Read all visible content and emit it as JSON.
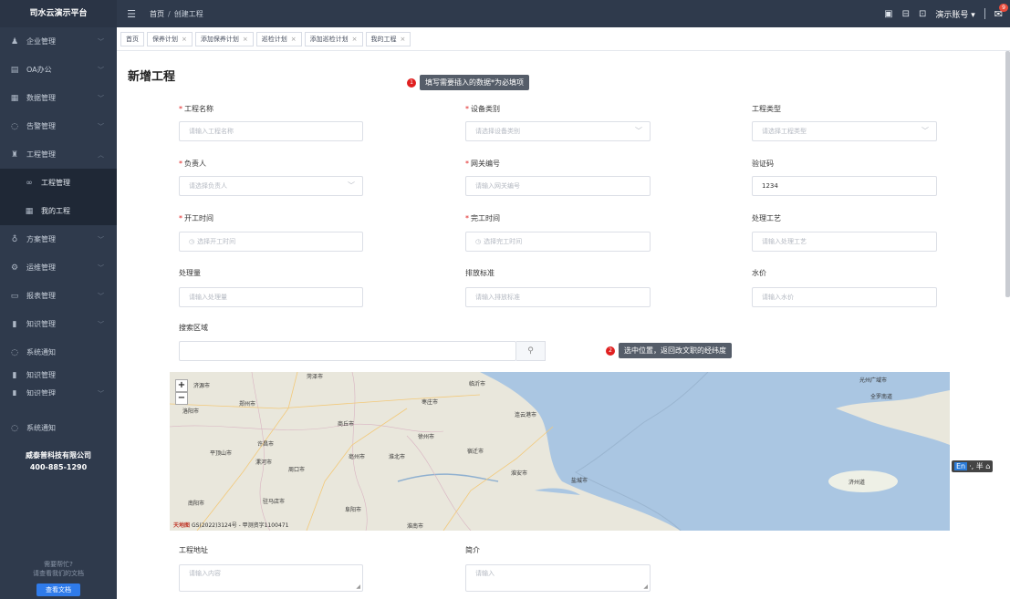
{
  "sidebar": {
    "brand": "司水云演示平台",
    "items": [
      {
        "icon": "user-icon",
        "label": "企业管理",
        "chev": "﹀"
      },
      {
        "icon": "document-icon",
        "label": "OA办公",
        "chev": "﹀"
      },
      {
        "icon": "database-icon",
        "label": "数据管理",
        "chev": "﹀"
      },
      {
        "icon": "alarm-icon",
        "label": "告警管理",
        "chev": "﹀"
      },
      {
        "icon": "project-icon",
        "label": "工程管理",
        "chev": "︿"
      }
    ],
    "sub_items": [
      {
        "icon": "link-icon",
        "label": "工程管理"
      },
      {
        "icon": "grid-icon",
        "label": "我的工程"
      }
    ],
    "items2": [
      {
        "icon": "scheme-icon",
        "label": "方案管理",
        "chev": "﹀"
      },
      {
        "icon": "ops-icon",
        "label": "运维管理",
        "chev": "﹀"
      },
      {
        "icon": "report-icon",
        "label": "报表管理",
        "chev": "﹀"
      },
      {
        "icon": "knowledge-icon",
        "label": "知识管理",
        "chev": "﹀"
      },
      {
        "icon": "notify-icon",
        "label": "系统通知",
        "chev": ""
      }
    ],
    "overlap_top": "知识管理",
    "overlap_bottom": "知识管理",
    "system_notice2": "系统通知",
    "company_name": "威泰普科技有限公司",
    "company_phone": "400-885-1290",
    "help_line1": "需要帮忙?",
    "help_line2": "请查看我们的文档",
    "doc_button": "查看文档"
  },
  "topbar": {
    "menu_toggle": "☰",
    "crumb_home": "首页",
    "crumb_sep": "/",
    "crumb_current": "创建工程",
    "user": "演示账号 ▾",
    "notify_badge": "9"
  },
  "tabs": [
    {
      "label": "首页",
      "closable": false
    },
    {
      "label": "保养计划",
      "closable": true
    },
    {
      "label": "添加保养计划",
      "closable": true
    },
    {
      "label": "巡检计划",
      "closable": true
    },
    {
      "label": "添加巡检计划",
      "closable": true
    },
    {
      "label": "我的工程",
      "closable": true
    }
  ],
  "form": {
    "title": "新增工程",
    "hint1_num": "1",
    "hint1": "填写需要插入的数据*为必填项",
    "hint2_num": "2",
    "hint2": "选中位置，返回改文职的经纬度",
    "project_name_label": "工程名称",
    "project_name_placeholder": "请输入工程名称",
    "device_type_label": "设备类别",
    "device_type_placeholder": "请选择设备类别",
    "project_type_label": "工程类型",
    "project_type_placeholder": "请选择工程类型",
    "owner_label": "负责人",
    "owner_placeholder": "请选择负责人",
    "gateway_label": "网关编号",
    "gateway_placeholder": "请输入网关编号",
    "code_label": "验证码",
    "code_value": "1234",
    "start_label": "开工时间",
    "start_placeholder": "选择开工时间",
    "end_label": "完工时间",
    "end_placeholder": "选择完工时间",
    "process_label": "处理工艺",
    "process_placeholder": "请输入处理工艺",
    "volume_label": "处理量",
    "volume_placeholder": "请输入处理量",
    "standard_label": "排放标准",
    "standard_placeholder": "请输入排放标准",
    "price_label": "水价",
    "price_placeholder": "请输入水价",
    "area_label": "搜索区域",
    "address_label": "工程地址",
    "address_placeholder": "请输入内容",
    "intro_label": "简介",
    "intro_placeholder": "请输入"
  },
  "map": {
    "zoom_in": "+",
    "zoom_out": "−",
    "copyright": "GS(2022)3124号 - 甲测资字1100471",
    "logo": "天地图",
    "cities": [
      "济源市",
      "郑州市",
      "洛阳市",
      "许昌市",
      "平顶山市",
      "漯河市",
      "周口市",
      "南阳市",
      "驻马店市",
      "阜阳市",
      "商丘市",
      "亳州市",
      "淮北市",
      "徐州市",
      "枣庄市",
      "临沂市",
      "菏泽市",
      "宿迁市",
      "连云港市",
      "淮安市",
      "盐城市",
      "淮南市",
      "济州道",
      "光州广域市",
      "全罗南道"
    ]
  },
  "ime": {
    "en": "En",
    "rest": "·, 半 ⌂"
  }
}
